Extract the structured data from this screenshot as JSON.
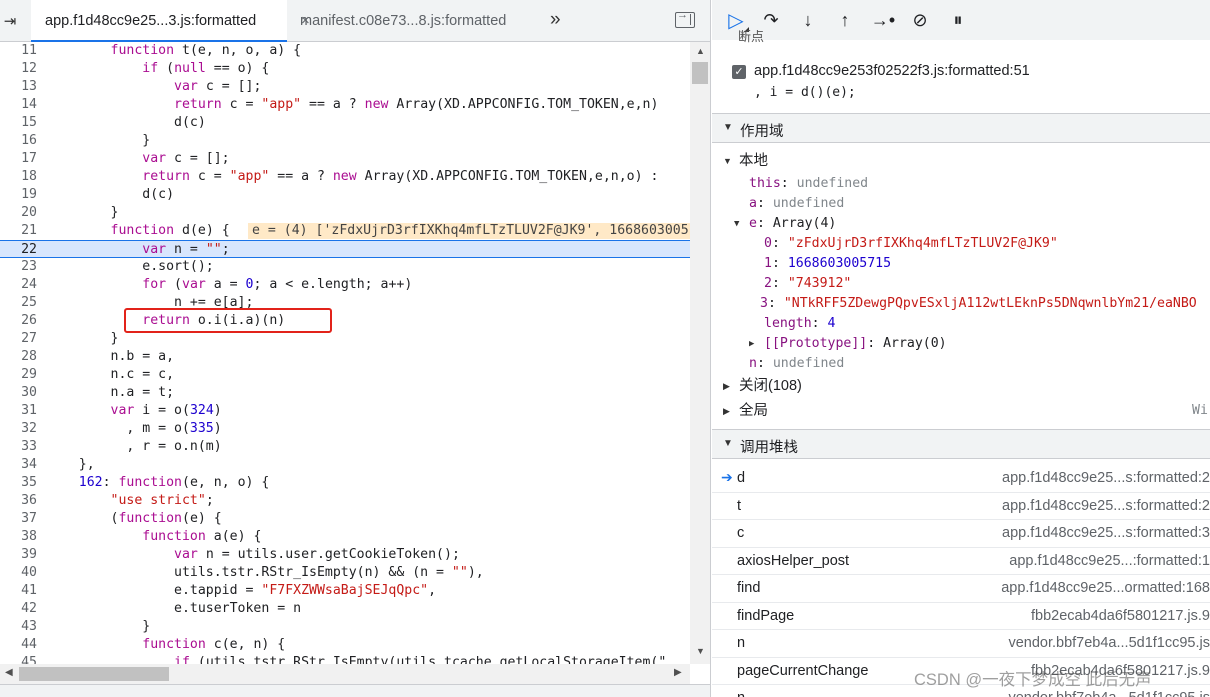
{
  "editor": {
    "nav_icon": "⇥",
    "tabs": [
      {
        "label": "app.f1d48cc9e25...3.js:formatted",
        "close": "×",
        "active": true
      },
      {
        "label": "manifest.c08e73...8.js:formatted",
        "active": false
      }
    ],
    "overflow": "»",
    "lines": [
      {
        "n": "11",
        "html": "        <span class='kw'>function</span> t(e, n, o, a) {"
      },
      {
        "n": "12",
        "html": "            <span class='kw'>if</span> (<span class='kw'>null</span> == o) {"
      },
      {
        "n": "13",
        "html": "                <span class='kw'>var</span> c = [];"
      },
      {
        "n": "14",
        "html": "                <span class='kw'>return</span> c = <span class='str'>\"app\"</span> == a ? <span class='kw'>new</span> Array(XD.APPCONFIG.TOM_TOKEN,e,n)"
      },
      {
        "n": "15",
        "html": "                d(c)"
      },
      {
        "n": "16",
        "html": "            }"
      },
      {
        "n": "17",
        "html": "            <span class='kw'>var</span> c = [];"
      },
      {
        "n": "18",
        "html": "            <span class='kw'>return</span> c = <span class='str'>\"app\"</span> == a ? <span class='kw'>new</span> Array(XD.APPCONFIG.TOM_TOKEN,e,n,o) :"
      },
      {
        "n": "19",
        "html": "            d(c)"
      },
      {
        "n": "20",
        "html": "        }"
      },
      {
        "n": "21",
        "html": "        <span class='kw'>function</span> d(e) {",
        "inline": "e = (4) ['zFdxUjrD3rfIXKhq4mfLTzTLUV2F@JK9', 1668603005"
      },
      {
        "n": "22",
        "html": "            <span class='kw'>var</span> n = <span class='str'>\"\"</span>;",
        "current": true
      },
      {
        "n": "23",
        "html": "            e.sort();"
      },
      {
        "n": "24",
        "html": "            <span class='kw'>for</span> (<span class='kw'>var</span> a = <span class='num'>0</span>; a &lt; e.length; a++)"
      },
      {
        "n": "25",
        "html": "                n += e[a];"
      },
      {
        "n": "26",
        "html": "            <span class='kw'>return</span> o.i(i.a)(n)"
      },
      {
        "n": "27",
        "html": "        }"
      },
      {
        "n": "28",
        "html": "        n.b = a,"
      },
      {
        "n": "29",
        "html": "        n.c = c,"
      },
      {
        "n": "30",
        "html": "        n.a = t;"
      },
      {
        "n": "31",
        "html": "        <span class='kw'>var</span> i = o(<span class='num'>324</span>)"
      },
      {
        "n": "32",
        "html": "          , m = o(<span class='num'>335</span>)"
      },
      {
        "n": "33",
        "html": "          , r = o.n(m)"
      },
      {
        "n": "34",
        "html": "    },"
      },
      {
        "n": "35",
        "html": "    <span class='num'>162</span>: <span class='kw'>function</span>(e, n, o) {"
      },
      {
        "n": "36",
        "html": "        <span class='str'>\"use strict\"</span>;"
      },
      {
        "n": "37",
        "html": "        (<span class='kw'>function</span>(e) {"
      },
      {
        "n": "38",
        "html": "            <span class='kw'>function</span> a(e) {"
      },
      {
        "n": "39",
        "html": "                <span class='kw'>var</span> n = utils.user.getCookieToken();"
      },
      {
        "n": "40",
        "html": "                utils.tstr.RStr_IsEmpty(n) &amp;&amp; (n = <span class='str'>\"\"</span>),"
      },
      {
        "n": "41",
        "html": "                e.tappid = <span class='str'>\"F7FXZWWsaBajSEJqQpc\"</span>,"
      },
      {
        "n": "42",
        "html": "                e.tuserToken = n"
      },
      {
        "n": "43",
        "html": "            }"
      },
      {
        "n": "44",
        "html": "            <span class='kw'>function</span> c(e, n) {"
      },
      {
        "n": "45",
        "html": "                <span class='kw'>if</span> (utils.tstr.RStr_IsEmpty(utils.tcache.getLocalStorageItem(\""
      }
    ]
  },
  "debugger": {
    "toolbar_icons": [
      "resume-icon",
      "step-over-icon",
      "step-into-icon",
      "step-out-icon",
      "step-icon",
      "deactivate-breakpoints-icon",
      "pause-on-exceptions-icon"
    ],
    "breakpoints_header": "断点",
    "breakpoint": {
      "label": "app.f1d48cc9e253f02522f3.js:formatted:51",
      "code": ", i = d()(e);"
    },
    "scope_header": "作用域",
    "scope": {
      "local_label": "本地",
      "this": {
        "key": "this",
        "val": "undefined"
      },
      "a": {
        "key": "a",
        "val": "undefined"
      },
      "e": {
        "key": "e",
        "val": "Array(4)"
      },
      "e_items": [
        {
          "k": "0",
          "v": "\"zFdxUjrD3rfIXKhq4mfLTzTLUV2F@JK9\""
        },
        {
          "k": "1",
          "v": "1668603005715"
        },
        {
          "k": "2",
          "v": "\"743912\""
        },
        {
          "k": "3",
          "v": "\"NTkRFF5ZDewgPQpvESxljA112wtLEknPs5DNqwnlbYm21/eaNBO"
        }
      ],
      "length": {
        "key": "length",
        "val": "4"
      },
      "prototype": {
        "key": "[[Prototype]]",
        "val": "Array(0)"
      },
      "n": {
        "key": "n",
        "val": "undefined"
      },
      "closure_label": "关闭(108)",
      "global_label": "全局",
      "global_val": "Wi"
    },
    "stack_header": "调用堆栈",
    "stack": [
      {
        "fn": "d",
        "loc": "app.f1d48cc9e25...s:formatted:2",
        "current": true
      },
      {
        "fn": "t",
        "loc": "app.f1d48cc9e25...s:formatted:2"
      },
      {
        "fn": "c",
        "loc": "app.f1d48cc9e25...s:formatted:3"
      },
      {
        "fn": "axiosHelper_post",
        "loc": "app.f1d48cc9e25...:formatted:1"
      },
      {
        "fn": "find",
        "loc": "app.f1d48cc9e25...ormatted:168"
      },
      {
        "fn": "findPage",
        "loc": "9.fbb2ecab4da6f5801217.js"
      },
      {
        "fn": "n",
        "loc": "vendor.bbf7eb4a...5d1f1cc95.js"
      },
      {
        "fn": "pageCurrentChange",
        "loc": "9.fbb2ecab4da6f5801217.js"
      },
      {
        "fn": "n",
        "loc": "vendor.bbf7eb4a...5d1f1cc95.js"
      }
    ]
  },
  "watermark": "CSDN @一夜下梦成空 此后无声"
}
